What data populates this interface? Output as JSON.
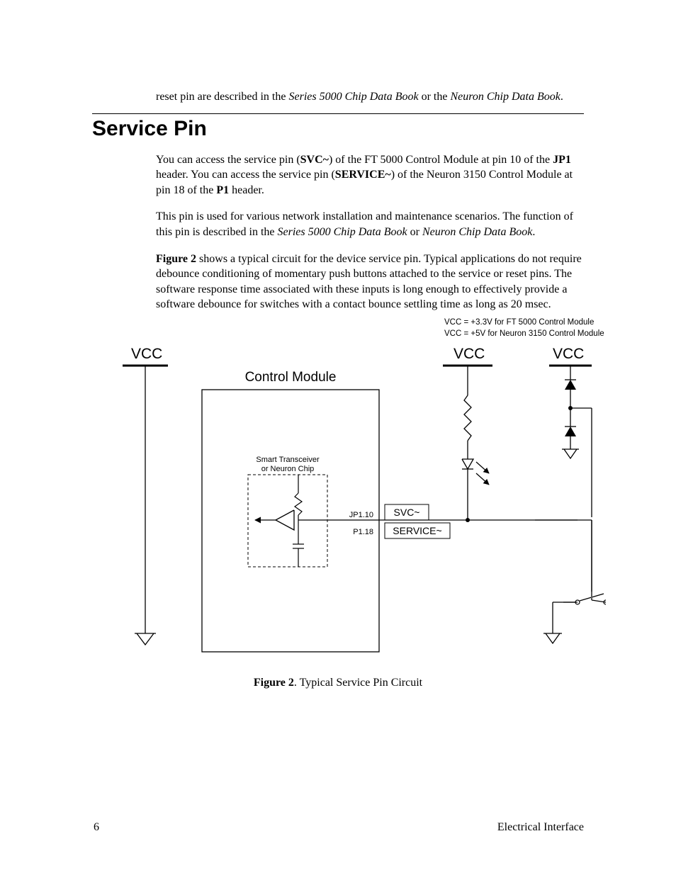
{
  "intro": {
    "part1": "reset pin are described in the ",
    "book1": "Series 5000 Chip Data Book",
    "mid": " or the ",
    "book2": "Neuron Chip Data Book",
    "end": "."
  },
  "section_title": "Service Pin",
  "p1": {
    "t1": "You can access the service pin (",
    "b1": "SVC~",
    "t2": ") of the FT 5000 Control Module at pin 10 of the ",
    "b2": "JP1",
    "t3": " header.  You can access the service pin (",
    "b3": "SERVICE~",
    "t4": ") of the Neuron 3150 Control Module at pin 18 of the ",
    "b4": "P1",
    "t5": " header."
  },
  "p2": {
    "t1": "This pin is used for various network installation and maintenance scenarios.  The function of this pin is described in the ",
    "i1": "Series 5000 Chip Data Book",
    "t2": " or ",
    "i2": "Neuron Chip Data Book",
    "t3": "."
  },
  "p3": {
    "b1": "Figure 2",
    "t1": " shows a typical circuit for the device service pin.  Typical applications do not require debounce conditioning of momentary push buttons attached to the service or reset pins.  The software response time associated with these inputs is long enough to effectively provide a software debounce for switches with a contact bounce settling time as long as 20 msec."
  },
  "notes": {
    "l1": "VCC = +3.3V for FT 5000 Control Module",
    "l2": "VCC = +5V for Neuron 3150 Control Module"
  },
  "diagram": {
    "vcc": "VCC",
    "control_module": "Control Module",
    "smart": "Smart Transceiver",
    "neuron": "or Neuron Chip",
    "jp": "JP1.10",
    "p1pin": "P1.18",
    "svc": "SVC~",
    "service": "SERVICE~"
  },
  "caption": {
    "b": "Figure 2",
    "t": ". Typical Service Pin Circuit"
  },
  "footer": {
    "page_num": "6",
    "chapter": "Electrical Interface"
  }
}
